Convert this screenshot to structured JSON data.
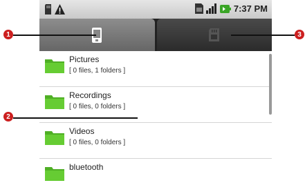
{
  "status_bar": {
    "time": "7:37 PM",
    "left_icons": [
      "sd-card-icon",
      "warning-icon"
    ],
    "right_icons": [
      "sim-icon",
      "signal-icon",
      "battery-icon"
    ]
  },
  "tabs": [
    {
      "name": "tab-phone",
      "icon": "phone-icon"
    },
    {
      "name": "tab-sd-card",
      "icon": "sd-card-icon"
    }
  ],
  "list": [
    {
      "name": "Pictures",
      "detail": "[ 0 files, 1 folders  ]"
    },
    {
      "name": "Recordings",
      "detail": "[ 0 files, 0 folders  ]"
    },
    {
      "name": "Videos",
      "detail": "[ 0 files, 0 folders  ]"
    },
    {
      "name": "bluetooth",
      "detail": ""
    }
  ],
  "callouts": [
    "1",
    "2",
    "3"
  ],
  "colors": {
    "callout": "#cc1f1f",
    "folder": "#5cbf2a",
    "tab_active": "#7a7a7a",
    "tab_inactive": "#333333"
  }
}
